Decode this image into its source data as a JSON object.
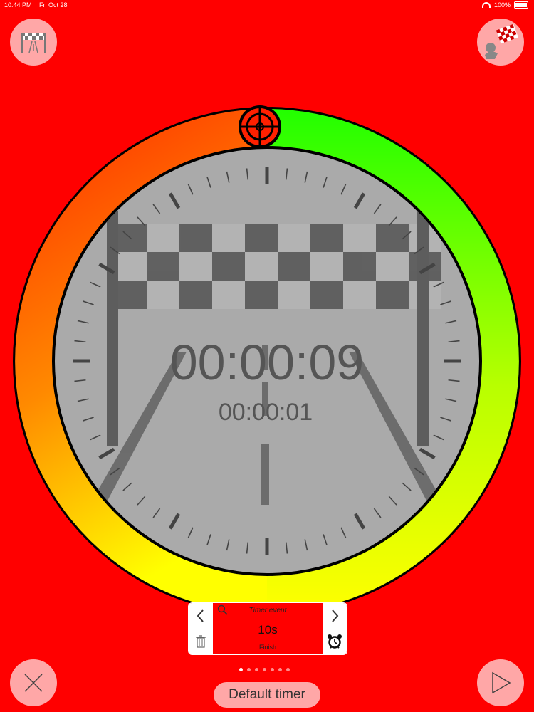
{
  "status_bar": {
    "time": "10:44 PM",
    "date": "Fri Oct 28",
    "battery": "100%"
  },
  "top_bar": {
    "left_icon": "finish-line-icon",
    "right_icon": "racing-flags-icon"
  },
  "dial": {
    "ring_colors": [
      "#ff2a00",
      "#ff8a00",
      "#ffff00",
      "#b8ff00",
      "#22ff00"
    ],
    "target_icon": "crosshair-icon",
    "main_time": "00:00:09",
    "sub_time": "00:00:01",
    "background_icon": "finish-line-road-icon"
  },
  "event_panel": {
    "title": "Timer event",
    "value": "10s",
    "subtitle": "Finish",
    "prev_icon": "chevron-left-icon",
    "next_icon": "chevron-right-icon",
    "delete_icon": "trash-icon",
    "alarm_icon": "alarm-clock-icon",
    "search_icon": "search-icon"
  },
  "pager": {
    "count": 7,
    "active_index": 0
  },
  "bottom_bar": {
    "preset_label": "Default timer",
    "cancel_icon": "close-icon",
    "play_icon": "play-icon"
  }
}
